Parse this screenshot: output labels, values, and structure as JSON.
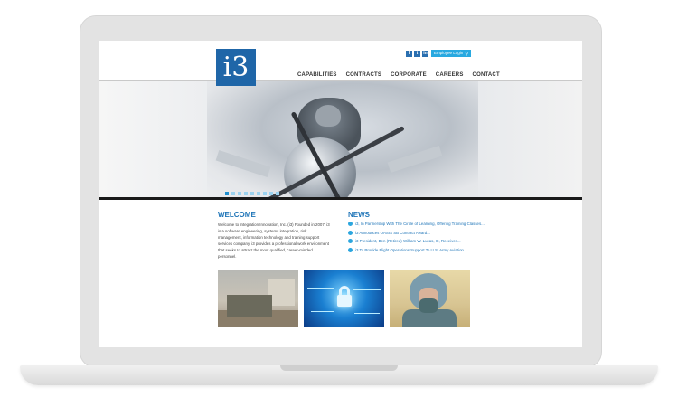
{
  "site": {
    "logo_text": "i3"
  },
  "header": {
    "social": [
      {
        "name": "facebook",
        "glyph": "f"
      },
      {
        "name": "twitter",
        "glyph": "t"
      },
      {
        "name": "linkedin",
        "glyph": "in"
      }
    ],
    "login_label": "Employee Login",
    "nav": [
      "CAPABILITIES",
      "CONTRACTS",
      "CORPORATE",
      "CAREERS",
      "CONTACT"
    ]
  },
  "hero": {
    "slide_count": 9,
    "active_slide": 1
  },
  "welcome": {
    "title": "WELCOME",
    "body": "Welcome to Integration Innovation, Inc. (i3) Founded in 2007, i3 is a software engineering, systems integration, risk management, information technology and training support services company. i3 provides a professional work environment that seeks to attract the most qualified, career-minded personnel."
  },
  "news": {
    "title": "NEWS",
    "items": [
      "i3, In Partnership With The Circle of Learning, Offering Training Classes...",
      "i3 Announces OASIS SB Contract Award...",
      "i3 President, Ben (Retired) William W. Lucas, III, Receives...",
      "i3 To Provide Flight Operations Support To U.S. Army Aviation..."
    ]
  },
  "colors": {
    "brand_blue": "#1f66a8",
    "accent_cyan": "#29a9e0",
    "title_blue": "#1f75b8"
  }
}
